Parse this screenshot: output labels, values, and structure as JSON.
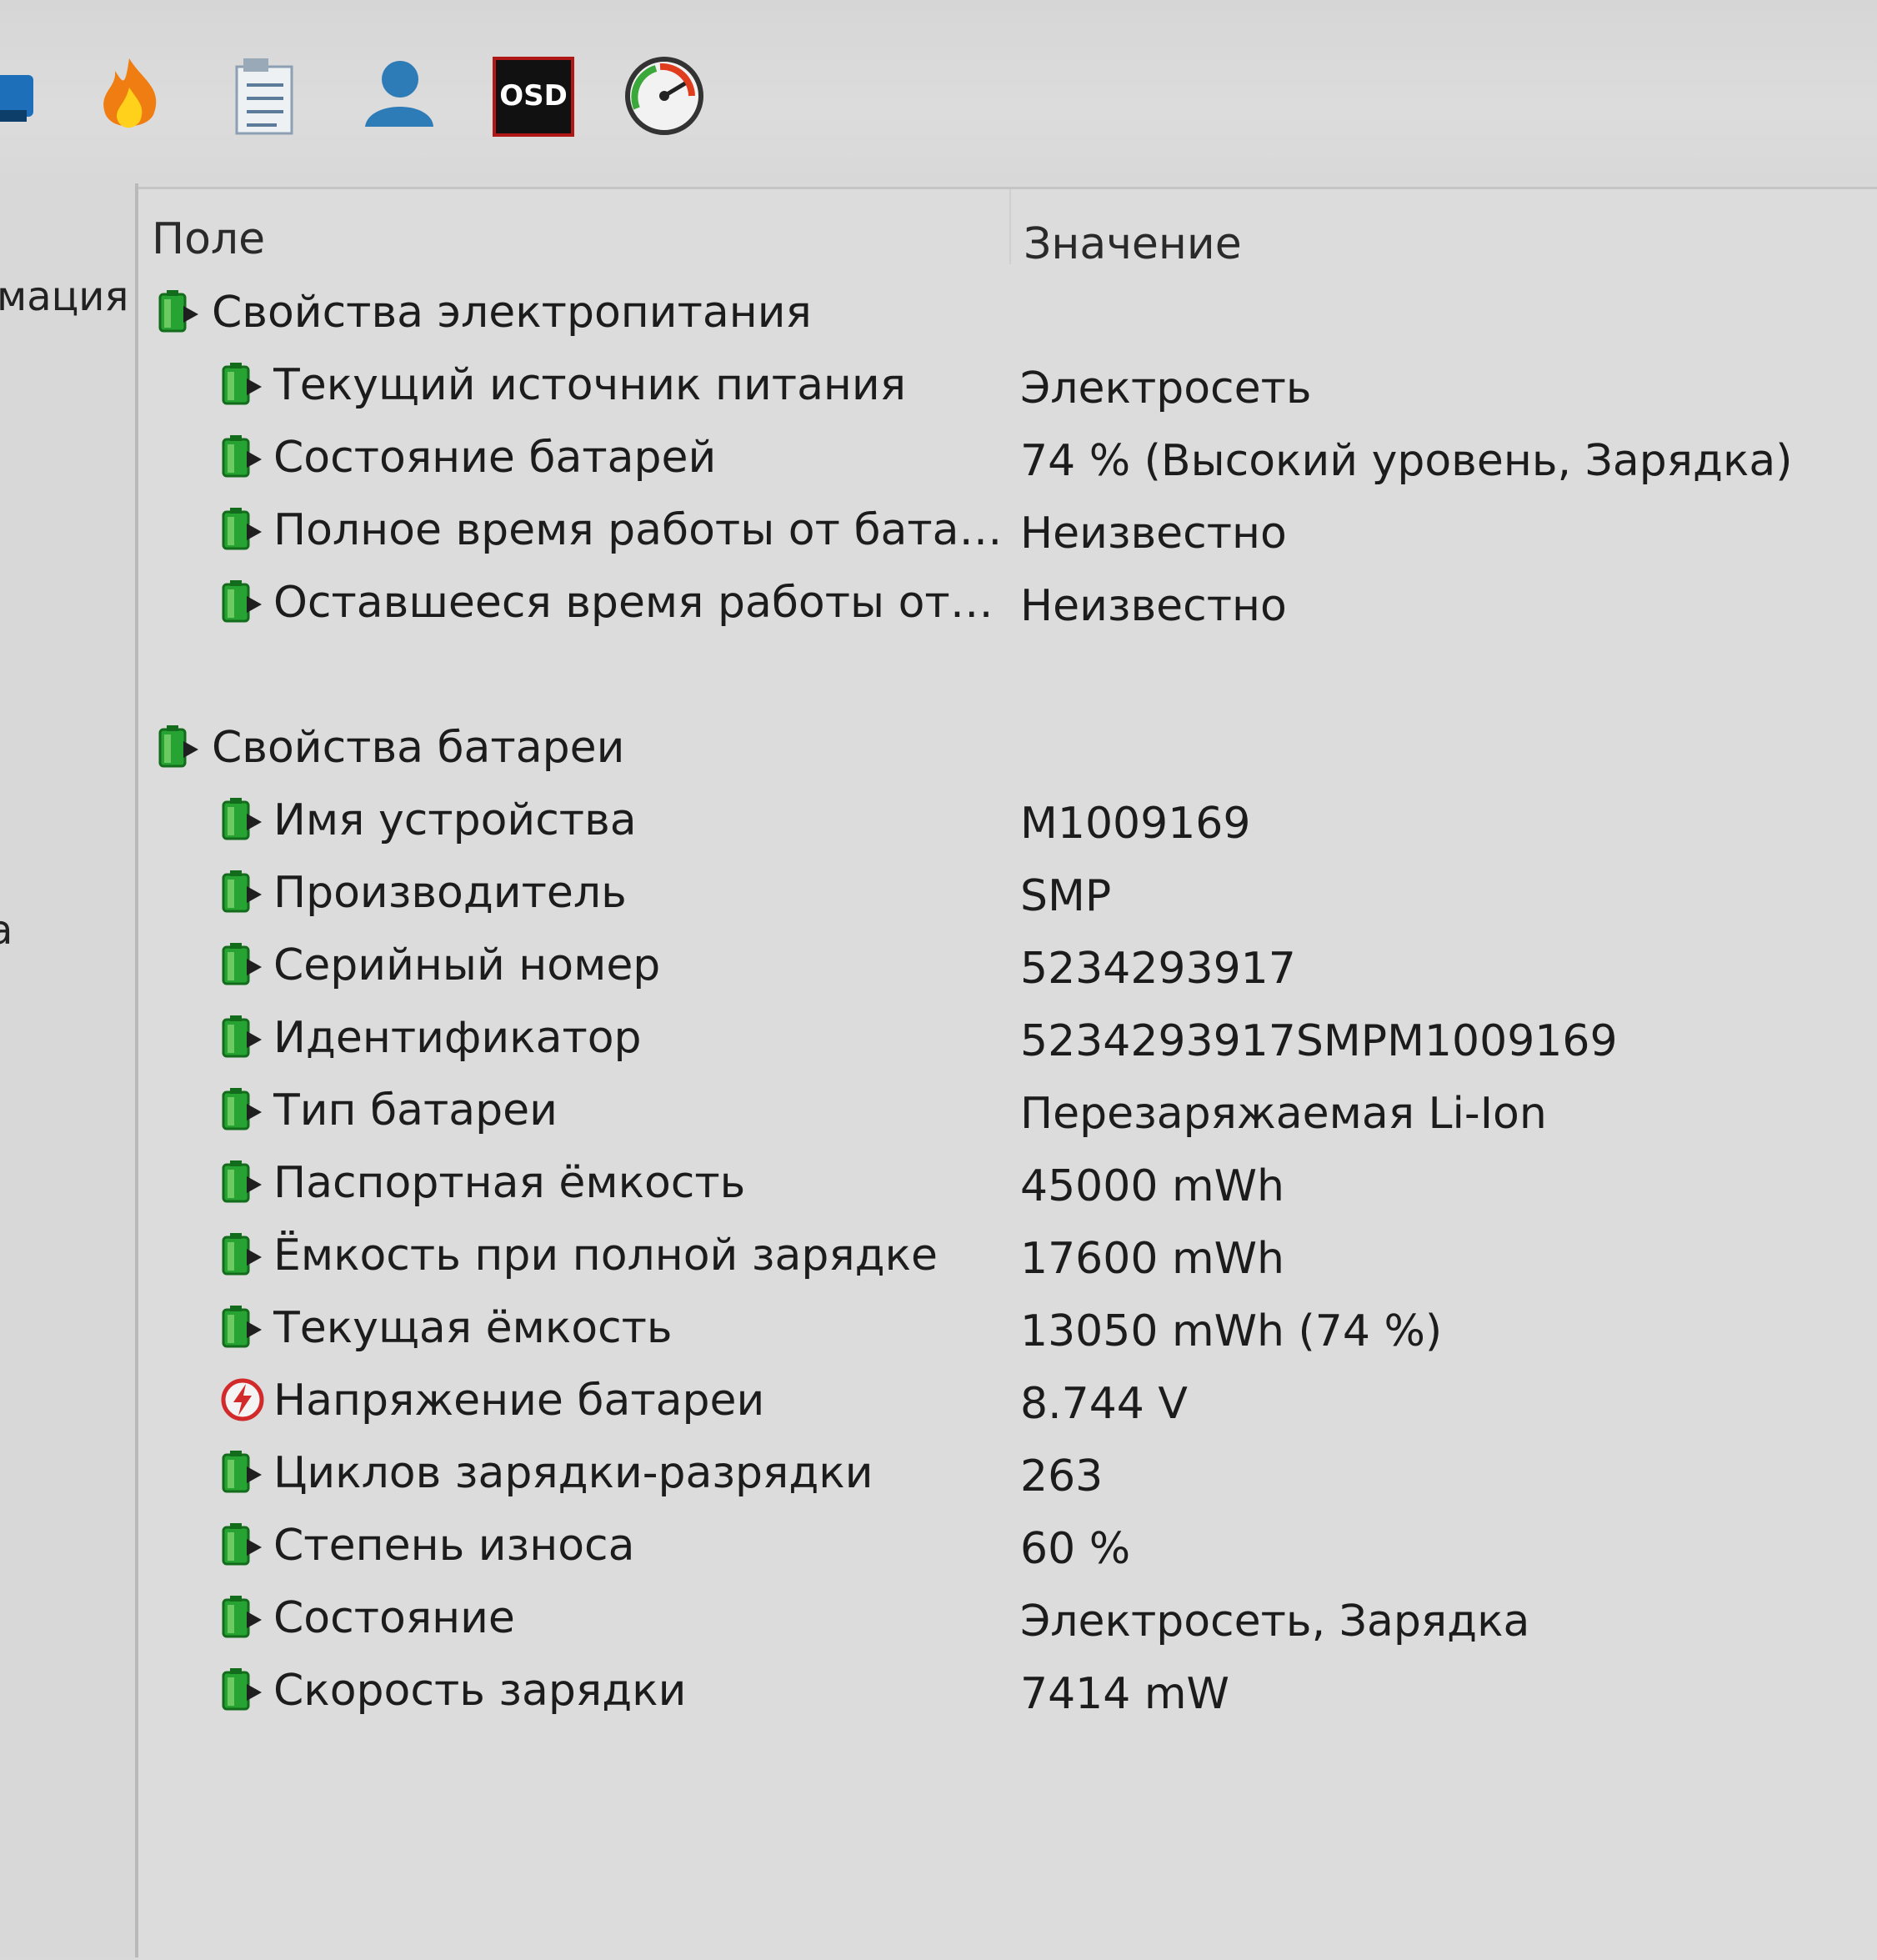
{
  "toolbar": {
    "icons": [
      "driver-icon",
      "flame-icon",
      "task-list-icon",
      "user-icon",
      "osd-icon",
      "gauge-icon"
    ],
    "osd_label": "OSD"
  },
  "sidebar": {
    "fragment_1": "мация",
    "fragment_2": "а"
  },
  "table": {
    "col_field": "Поле",
    "col_value": "Значение",
    "groups": [
      {
        "title": "Свойства электропитания",
        "rows": [
          {
            "field": "Текущий источник питания",
            "value": "Электросеть",
            "icon": "battery-icon"
          },
          {
            "field": "Состояние батарей",
            "value": "74 % (Высокий уровень, Зарядка)",
            "icon": "battery-icon"
          },
          {
            "field": "Полное время работы от батар...",
            "value": "Неизвестно",
            "icon": "battery-icon"
          },
          {
            "field": "Оставшееся время работы от б...",
            "value": "Неизвестно",
            "icon": "battery-icon"
          }
        ]
      },
      {
        "title": "Свойства батареи",
        "rows": [
          {
            "field": "Имя устройства",
            "value": "M1009169",
            "icon": "battery-icon"
          },
          {
            "field": "Производитель",
            "value": "SMP",
            "icon": "battery-icon"
          },
          {
            "field": "Серийный номер",
            "value": "5234293917",
            "icon": "battery-icon"
          },
          {
            "field": "Идентификатор",
            "value": "5234293917SMPM1009169",
            "icon": "battery-icon"
          },
          {
            "field": "Тип батареи",
            "value": "Перезаряжаемая Li-Ion",
            "icon": "battery-icon"
          },
          {
            "field": "Паспортная ёмкость",
            "value": "45000 mWh",
            "icon": "battery-icon"
          },
          {
            "field": "Ёмкость при полной зарядке",
            "value": "17600 mWh",
            "icon": "battery-icon"
          },
          {
            "field": "Текущая ёмкость",
            "value": "13050 mWh  (74 %)",
            "icon": "battery-icon"
          },
          {
            "field": "Напряжение батареи",
            "value": "8.744 V",
            "icon": "voltage-icon"
          },
          {
            "field": "Циклов зарядки-разрядки",
            "value": "263",
            "icon": "battery-icon"
          },
          {
            "field": "Степень износа",
            "value": "60 %",
            "icon": "battery-icon"
          },
          {
            "field": "Состояние",
            "value": "Электросеть, Зарядка",
            "icon": "battery-icon"
          },
          {
            "field": "Скорость зарядки",
            "value": "7414 mW",
            "icon": "battery-icon"
          }
        ]
      }
    ]
  }
}
